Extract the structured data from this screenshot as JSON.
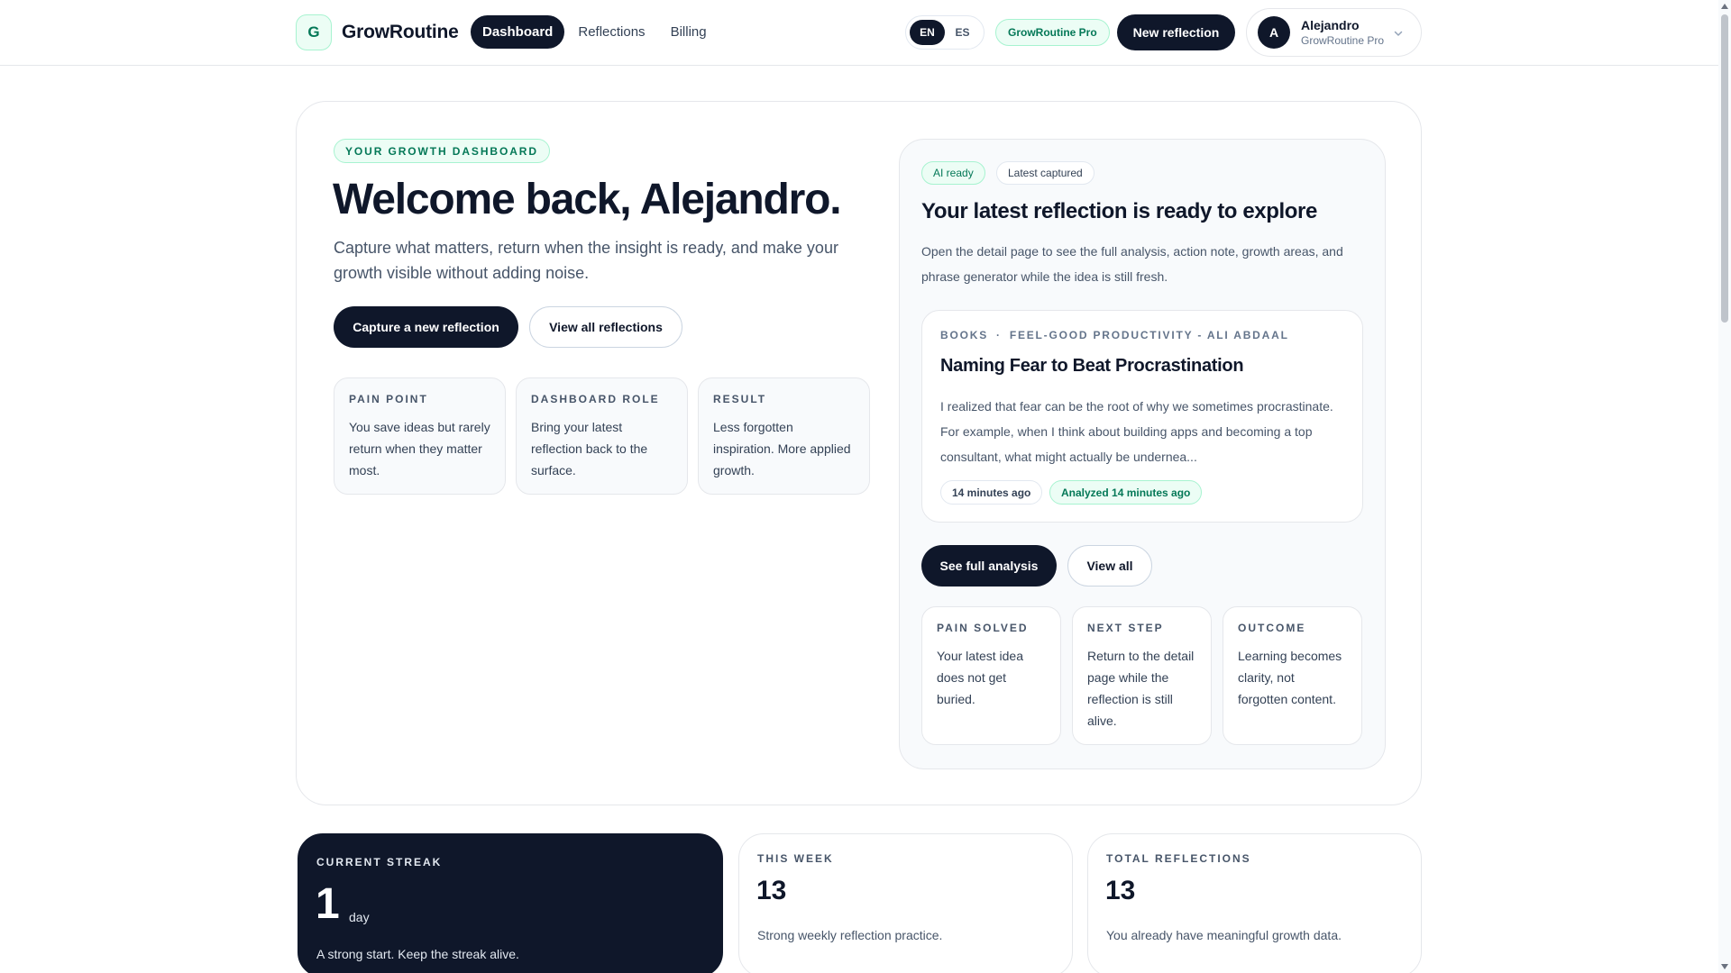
{
  "app": {
    "brand_initial": "G",
    "brand_name": "GrowRoutine"
  },
  "nav": {
    "items": [
      {
        "label": "Dashboard",
        "active": true
      },
      {
        "label": "Reflections",
        "active": false
      },
      {
        "label": "Billing",
        "active": false
      }
    ],
    "languages": [
      {
        "label": "EN",
        "active": true
      },
      {
        "label": "ES",
        "active": false
      }
    ],
    "plan_badge": "GrowRoutine Pro",
    "new_reflection_label": "New reflection",
    "user": {
      "initial": "A",
      "name": "Alejandro",
      "plan": "GrowRoutine Pro"
    }
  },
  "hero": {
    "eyebrow": "YOUR GROWTH DASHBOARD",
    "title": "Welcome back, Alejandro.",
    "lead": "Capture what matters, return when the insight is ready, and make your growth visible without adding noise.",
    "primary_cta": "Capture a new reflection",
    "secondary_cta": "View all reflections",
    "cards": [
      {
        "label": "PAIN POINT",
        "text": "You save ideas but rarely return when they matter most."
      },
      {
        "label": "DASHBOARD ROLE",
        "text": "Bring your latest reflection back to the surface."
      },
      {
        "label": "RESULT",
        "text": "Less forgotten inspiration. More applied growth."
      }
    ]
  },
  "latest": {
    "badges": [
      "AI ready",
      "Latest captured"
    ],
    "title": "Your latest reflection is ready to explore",
    "description": "Open the detail page to see the full analysis, action note, growth areas, and phrase generator while the idea is still fresh.",
    "entry": {
      "category": "BOOKS",
      "separator": "·",
      "source": "FEEL-GOOD PRODUCTIVITY - ALI ABDAAL",
      "title": "Naming Fear to Beat Procrastination",
      "excerpt": "I realized that fear can be the root of why we sometimes procrastinate. For example, when I think about building apps and becoming a top consultant, what might actually be underneа...",
      "created": "14 minutes ago",
      "analyzed": "Analyzed 14 minutes ago"
    },
    "primary_cta": "See full analysis",
    "secondary_cta": "View all",
    "cards": [
      {
        "label": "PAIN SOLVED",
        "text": "Your latest idea does not get buried."
      },
      {
        "label": "NEXT STEP",
        "text": "Return to the detail page while the reflection is still alive."
      },
      {
        "label": "OUTCOME",
        "text": "Learning becomes clarity, not forgotten content."
      }
    ]
  },
  "stats": [
    {
      "label": "CURRENT STREAK",
      "value": "1",
      "unit": "day",
      "note": "A strong start. Keep the streak alive."
    },
    {
      "label": "THIS WEEK",
      "value": "13",
      "note": "Strong weekly reflection practice."
    },
    {
      "label": "TOTAL REFLECTIONS",
      "value": "13",
      "note": "You already have meaningful growth data."
    }
  ],
  "colors": {
    "primary": "#0f172a",
    "accent_green": "#047857",
    "accent_green_bg": "#ecfdf5"
  },
  "icons": {
    "user_menu": "chevron-down-icon"
  }
}
